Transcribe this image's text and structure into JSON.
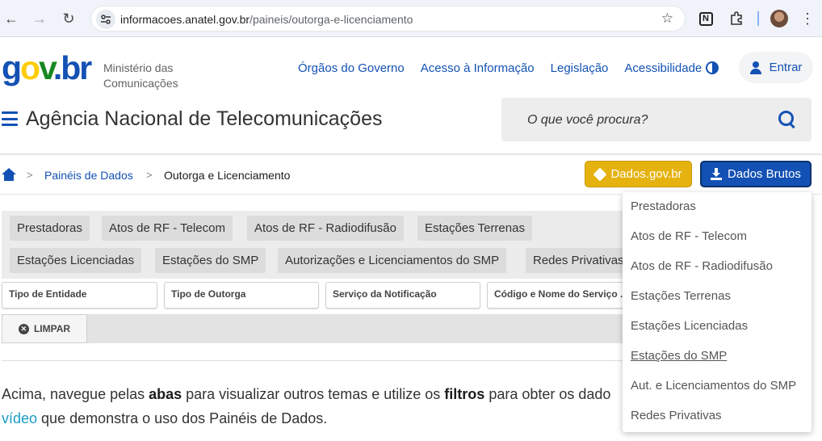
{
  "browser": {
    "url_host": "informacoes.anatel.gov.br",
    "url_path": "/paineis/outorga-e-licenciamento",
    "extension_label": "N"
  },
  "header": {
    "logo": {
      "g": "g",
      "o": "o",
      "v": "v",
      "dot": ".",
      "br": "br"
    },
    "ministry_line1": "Ministério das",
    "ministry_line2": "Comunicações",
    "links": [
      "Órgãos do Governo",
      "Acesso à Informação",
      "Legislação",
      "Acessibilidade"
    ],
    "login_label": "Entrar",
    "agency_title": "Agência Nacional de Telecomunicações",
    "search_placeholder": "O que você procura?"
  },
  "breadcrumb": {
    "separator": ">",
    "link": "Painéis de Dados",
    "current": "Outorga e Licenciamento"
  },
  "actions": {
    "dados_gov_label": "Dados.gov.br",
    "dados_brutos_label": "Dados Brutos"
  },
  "tabs": [
    "Prestadoras",
    "Atos de RF - Telecom",
    "Atos de RF - Radiodifusão",
    "Estações Terrenas",
    "Estações Licenciadas",
    "Estações do SMP",
    "Autorizações e Licenciamentos do SMP",
    "Redes Privativas"
  ],
  "filters": [
    "Tipo de Entidade",
    "Tipo de Outorga",
    "Serviço da Notificação",
    "Código e Nome do Serviço ..."
  ],
  "clear_label": "LIMPAR",
  "paragraph": {
    "line1_a": "Acima, navegue pelas ",
    "line1_b": "abas",
    "line1_c": " para visualizar outros temas e utilize os ",
    "line1_d": "filtros",
    "line1_e": " para obter os dado",
    "line2_link": "vídeo",
    "line2_rest": " que demonstra o uso dos Painéis de Dados."
  },
  "dropdown": {
    "items": [
      "Prestadoras",
      "Atos de RF - Telecom",
      "Atos de RF - Radiodifusão",
      "Estações Terrenas",
      "Estações Licenciadas",
      "Estações do SMP",
      "Aut. e Licenciamentos do SMP",
      "Redes Privativas"
    ],
    "hovered_index": 5
  },
  "colors": {
    "primary": "#1351b4",
    "dados_gov": "#e5b20f",
    "link_teal": "#1a9bc7"
  }
}
